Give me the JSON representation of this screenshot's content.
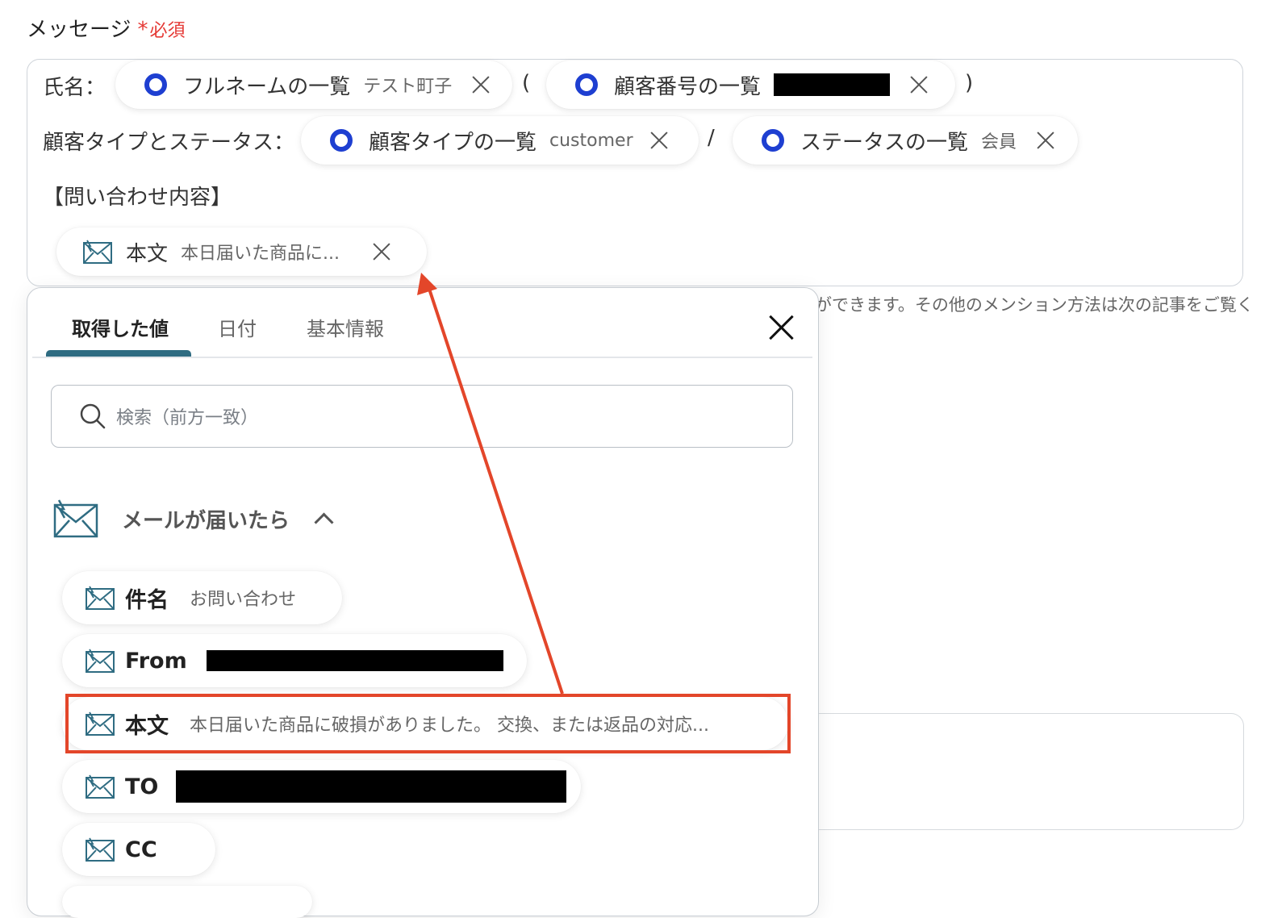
{
  "field": {
    "label": "メッセージ",
    "required_mark": "*",
    "required_text": "必須"
  },
  "message": {
    "line1_prefix": "氏名：",
    "paren_open": "(",
    "paren_close": ")",
    "line2_prefix": "顧客タイプとステータス：",
    "slash": "/",
    "line3": "【問い合わせ内容】",
    "tokens": [
      {
        "label": "フルネームの一覧",
        "value": "テスト町子",
        "icon": "ring-icon"
      },
      {
        "label": "顧客番号の一覧",
        "value": "",
        "redacted": true,
        "icon": "ring-icon"
      },
      {
        "label": "顧客タイプの一覧",
        "value": "customer",
        "icon": "ring-icon"
      },
      {
        "label": "ステータスの一覧",
        "value": "会員",
        "icon": "ring-icon"
      },
      {
        "label": "本文",
        "value": "本日届いた商品に...",
        "icon": "mail-icon"
      }
    ]
  },
  "helper_text": "ができます。その他のメンション方法は次の記事をご覧く",
  "popup": {
    "tabs": [
      {
        "label": "取得した値",
        "active": true
      },
      {
        "label": "日付"
      },
      {
        "label": "基本情報"
      }
    ],
    "search_placeholder": "検索（前方一致）",
    "section": {
      "title": "メールが届いたら",
      "icon": "mail-icon",
      "expanded": true
    },
    "items": [
      {
        "label": "件名",
        "value": "お問い合わせ",
        "icon": "mail-icon"
      },
      {
        "label": "From",
        "value": "",
        "redacted": true,
        "icon": "mail-icon"
      },
      {
        "label": "本文",
        "value": "本日届いた商品に破損がありました。 交換、または返品の対応...",
        "icon": "mail-icon",
        "highlighted": true
      },
      {
        "label": "TO",
        "value": "",
        "redacted": true,
        "icon": "mail-icon"
      },
      {
        "label": "CC",
        "value": "",
        "icon": "mail-icon"
      }
    ]
  },
  "colors": {
    "accent": "#2f6c82",
    "ring": "#1e3fd1",
    "required": "#e53935",
    "annotation": "#e3462a"
  }
}
